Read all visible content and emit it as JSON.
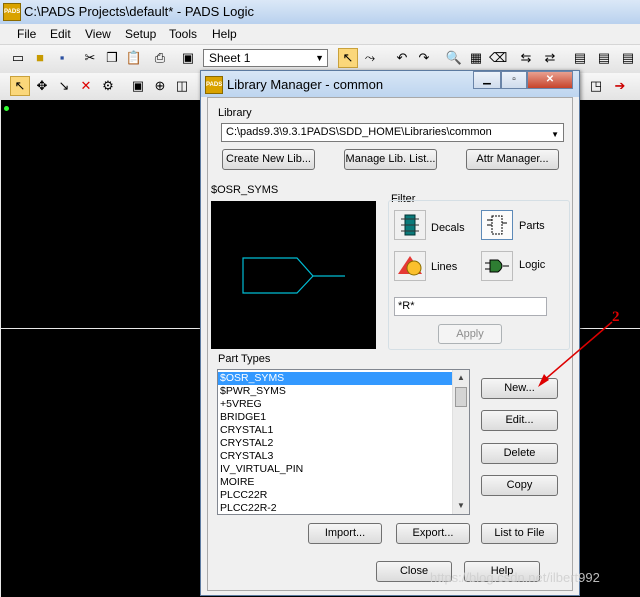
{
  "app": {
    "title": "C:\\PADS Projects\\default* - PADS Logic",
    "logo_text": "PADS"
  },
  "menu": [
    "File",
    "Edit",
    "View",
    "Setup",
    "Tools",
    "Help"
  ],
  "toolbar": {
    "sheet_value": "Sheet 1"
  },
  "dialog": {
    "title": "Library Manager - common",
    "logo_text": "PADS",
    "library_label": "Library",
    "library_path": "C:\\pads9.3\\9.3.1PADS\\SDD_HOME\\Libraries\\common",
    "buttons": {
      "create_lib": "Create New Lib...",
      "manage_lib": "Manage Lib. List...",
      "attr_manager": "Attr Manager...",
      "apply": "Apply",
      "new": "New...",
      "edit": "Edit...",
      "delete": "Delete",
      "copy": "Copy",
      "import": "Import...",
      "export": "Export...",
      "list_to_file": "List to File",
      "close": "Close",
      "help": "Help"
    },
    "preview_label": "$OSR_SYMS",
    "filter_label": "Filter",
    "filter_options": {
      "decals": "Decals",
      "parts": "Parts",
      "lines": "Lines",
      "logic": "Logic"
    },
    "filter_text": "*R*",
    "part_types_label": "Part Types",
    "part_types": [
      "$OSR_SYMS",
      "$PWR_SYMS",
      "+5VREG",
      "BRIDGE1",
      "CRYSTAL1",
      "CRYSTAL2",
      "CRYSTAL3",
      "IV_VIRTUAL_PIN",
      "MOIRE",
      "PLCC22R",
      "PLCC22R-2"
    ],
    "selected_part": "$OSR_SYMS"
  },
  "annotation": {
    "number": "2"
  },
  "watermark": "https://blog.csdn.net/ilbert992",
  "colors": {
    "selection": "#3399ff",
    "preview_symbol": "#00bcd4",
    "annotation": "#dd0000"
  }
}
